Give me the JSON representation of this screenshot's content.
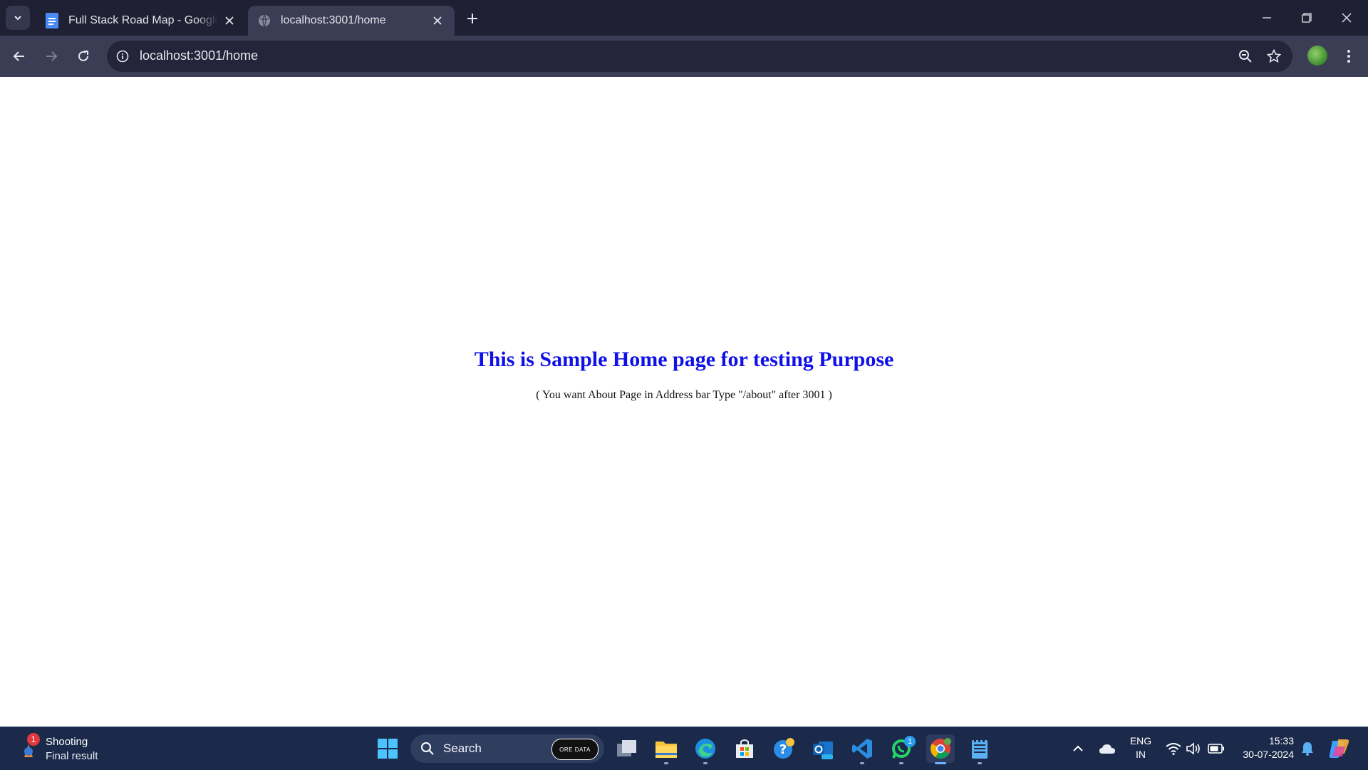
{
  "browser": {
    "tabs": [
      {
        "title": "Full Stack Road Map - Google D",
        "icon": "google-docs-icon",
        "active": false
      },
      {
        "title": "localhost:3001/home",
        "icon": "globe-icon",
        "active": true
      }
    ],
    "address_bar": {
      "url": "localhost:3001/home"
    }
  },
  "page": {
    "heading": "This is Sample Home page for testing Purpose",
    "subtext": "( You want About Page in Address bar Type \"/about\" after 3001 )",
    "heading_color": "#1010e8"
  },
  "taskbar": {
    "weather": {
      "line1": "Shooting",
      "line2": "Final result",
      "badge": "1"
    },
    "search_label": "Search",
    "search_thumb_text": "ORE DATA",
    "pinned": [
      {
        "name": "start-icon"
      },
      {
        "name": "task-view-icon"
      },
      {
        "name": "file-explorer-icon"
      },
      {
        "name": "edge-icon"
      },
      {
        "name": "microsoft-store-icon"
      },
      {
        "name": "get-help-icon"
      },
      {
        "name": "outlook-icon"
      },
      {
        "name": "vscode-icon"
      },
      {
        "name": "whatsapp-icon",
        "badge": "1"
      },
      {
        "name": "chrome-icon"
      },
      {
        "name": "notepad-icon"
      }
    ],
    "tray": {
      "lang_line1": "ENG",
      "lang_line2": "IN",
      "time": "15:33",
      "date": "30-07-2024"
    }
  }
}
